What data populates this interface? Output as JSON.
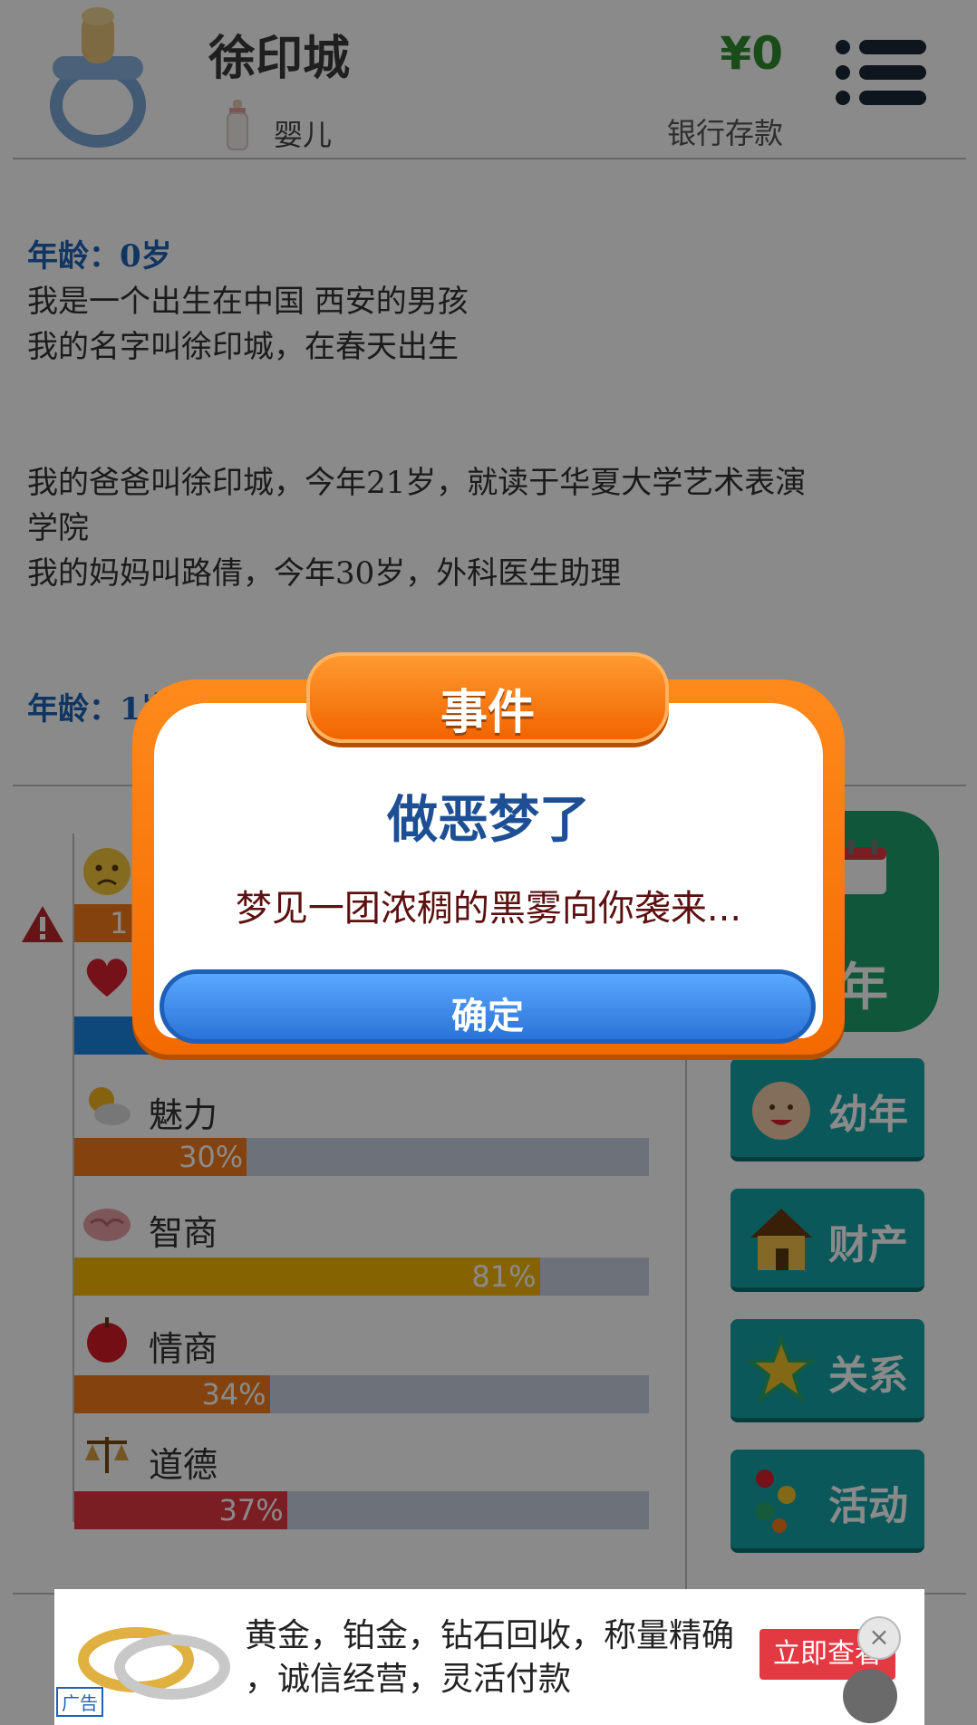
{
  "header": {
    "name": "徐印城",
    "stage": "婴儿",
    "money": "¥0",
    "bank_label": "银行存款"
  },
  "log": {
    "entries": [
      {
        "age": "年龄：0岁",
        "lines": [
          "我是一个出生在中国 西安的男孩",
          "我的名字叫徐印城，在春天出生"
        ]
      },
      {
        "lines": [
          "我的爸爸叫徐印城，今年21岁，就读于华夏大学艺术表演",
          "学院",
          "我的妈妈叫路倩，今年30岁，外科医生助理"
        ]
      },
      {
        "age": "年龄：1岁"
      }
    ]
  },
  "stats": [
    {
      "label": "快乐",
      "value": 0.1,
      "pct_text": "1",
      "color": "#f47d1a",
      "icon": "sad-face-icon"
    },
    {
      "label": "健康",
      "value": 0.88,
      "pct_text": "",
      "color": "#1a84e0",
      "icon": "heart-icon"
    },
    {
      "label": "魅力",
      "value": 0.3,
      "pct_text": "30%",
      "color": "#f47d1a",
      "icon": "sun-cloud-icon"
    },
    {
      "label": "智商",
      "value": 0.81,
      "pct_text": "81%",
      "color": "#f5b800",
      "icon": "brain-icon"
    },
    {
      "label": "情商",
      "value": 0.34,
      "pct_text": "34%",
      "color": "#f47d1a",
      "icon": "apple-icon"
    },
    {
      "label": "道德",
      "value": 0.37,
      "pct_text": "37%",
      "color": "#e23942",
      "icon": "scales-icon"
    }
  ],
  "side_buttons": {
    "age_up": "年",
    "childhood": "幼年",
    "property": "财产",
    "relations": "关系",
    "activities": "活动"
  },
  "dialog": {
    "tab": "事件",
    "title": "做恶梦了",
    "message": "梦见一团浓稠的黑雾向你袭来...",
    "ok": "确定"
  },
  "ad": {
    "line1": "黄金，铂金，钻石回收，称量精确",
    "line2": "，诚信经营，灵活付款",
    "tag": "广告",
    "cta": "立即查看",
    "close": "×"
  }
}
